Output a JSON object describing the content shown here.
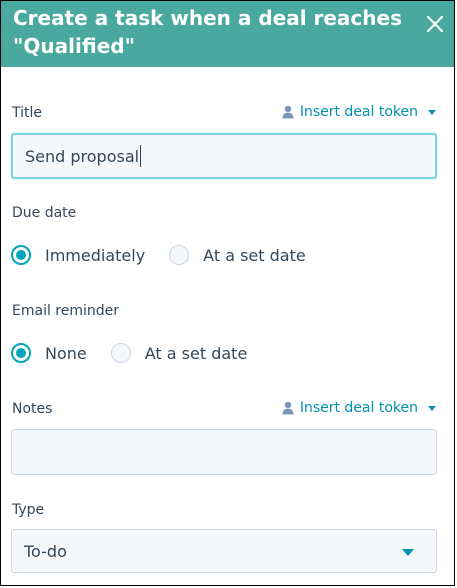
{
  "dialog": {
    "title": "Create a task when a deal reaches \"Qualified\"",
    "close_icon": "close-icon"
  },
  "title_field": {
    "label": "Title",
    "token_link": "Insert deal token",
    "value": "Send proposal"
  },
  "due_date": {
    "label": "Due date",
    "options": [
      "Immediately",
      "At a set date"
    ],
    "selected": "Immediately"
  },
  "email_reminder": {
    "label": "Email reminder",
    "options": [
      "None",
      "At a set date"
    ],
    "selected": "None"
  },
  "notes": {
    "label": "Notes",
    "token_link": "Insert deal token",
    "value": ""
  },
  "type": {
    "label": "Type",
    "value": "To-do"
  },
  "colors": {
    "header": "#4aa99e",
    "accent": "#00a4bd",
    "link": "#0091ae"
  }
}
